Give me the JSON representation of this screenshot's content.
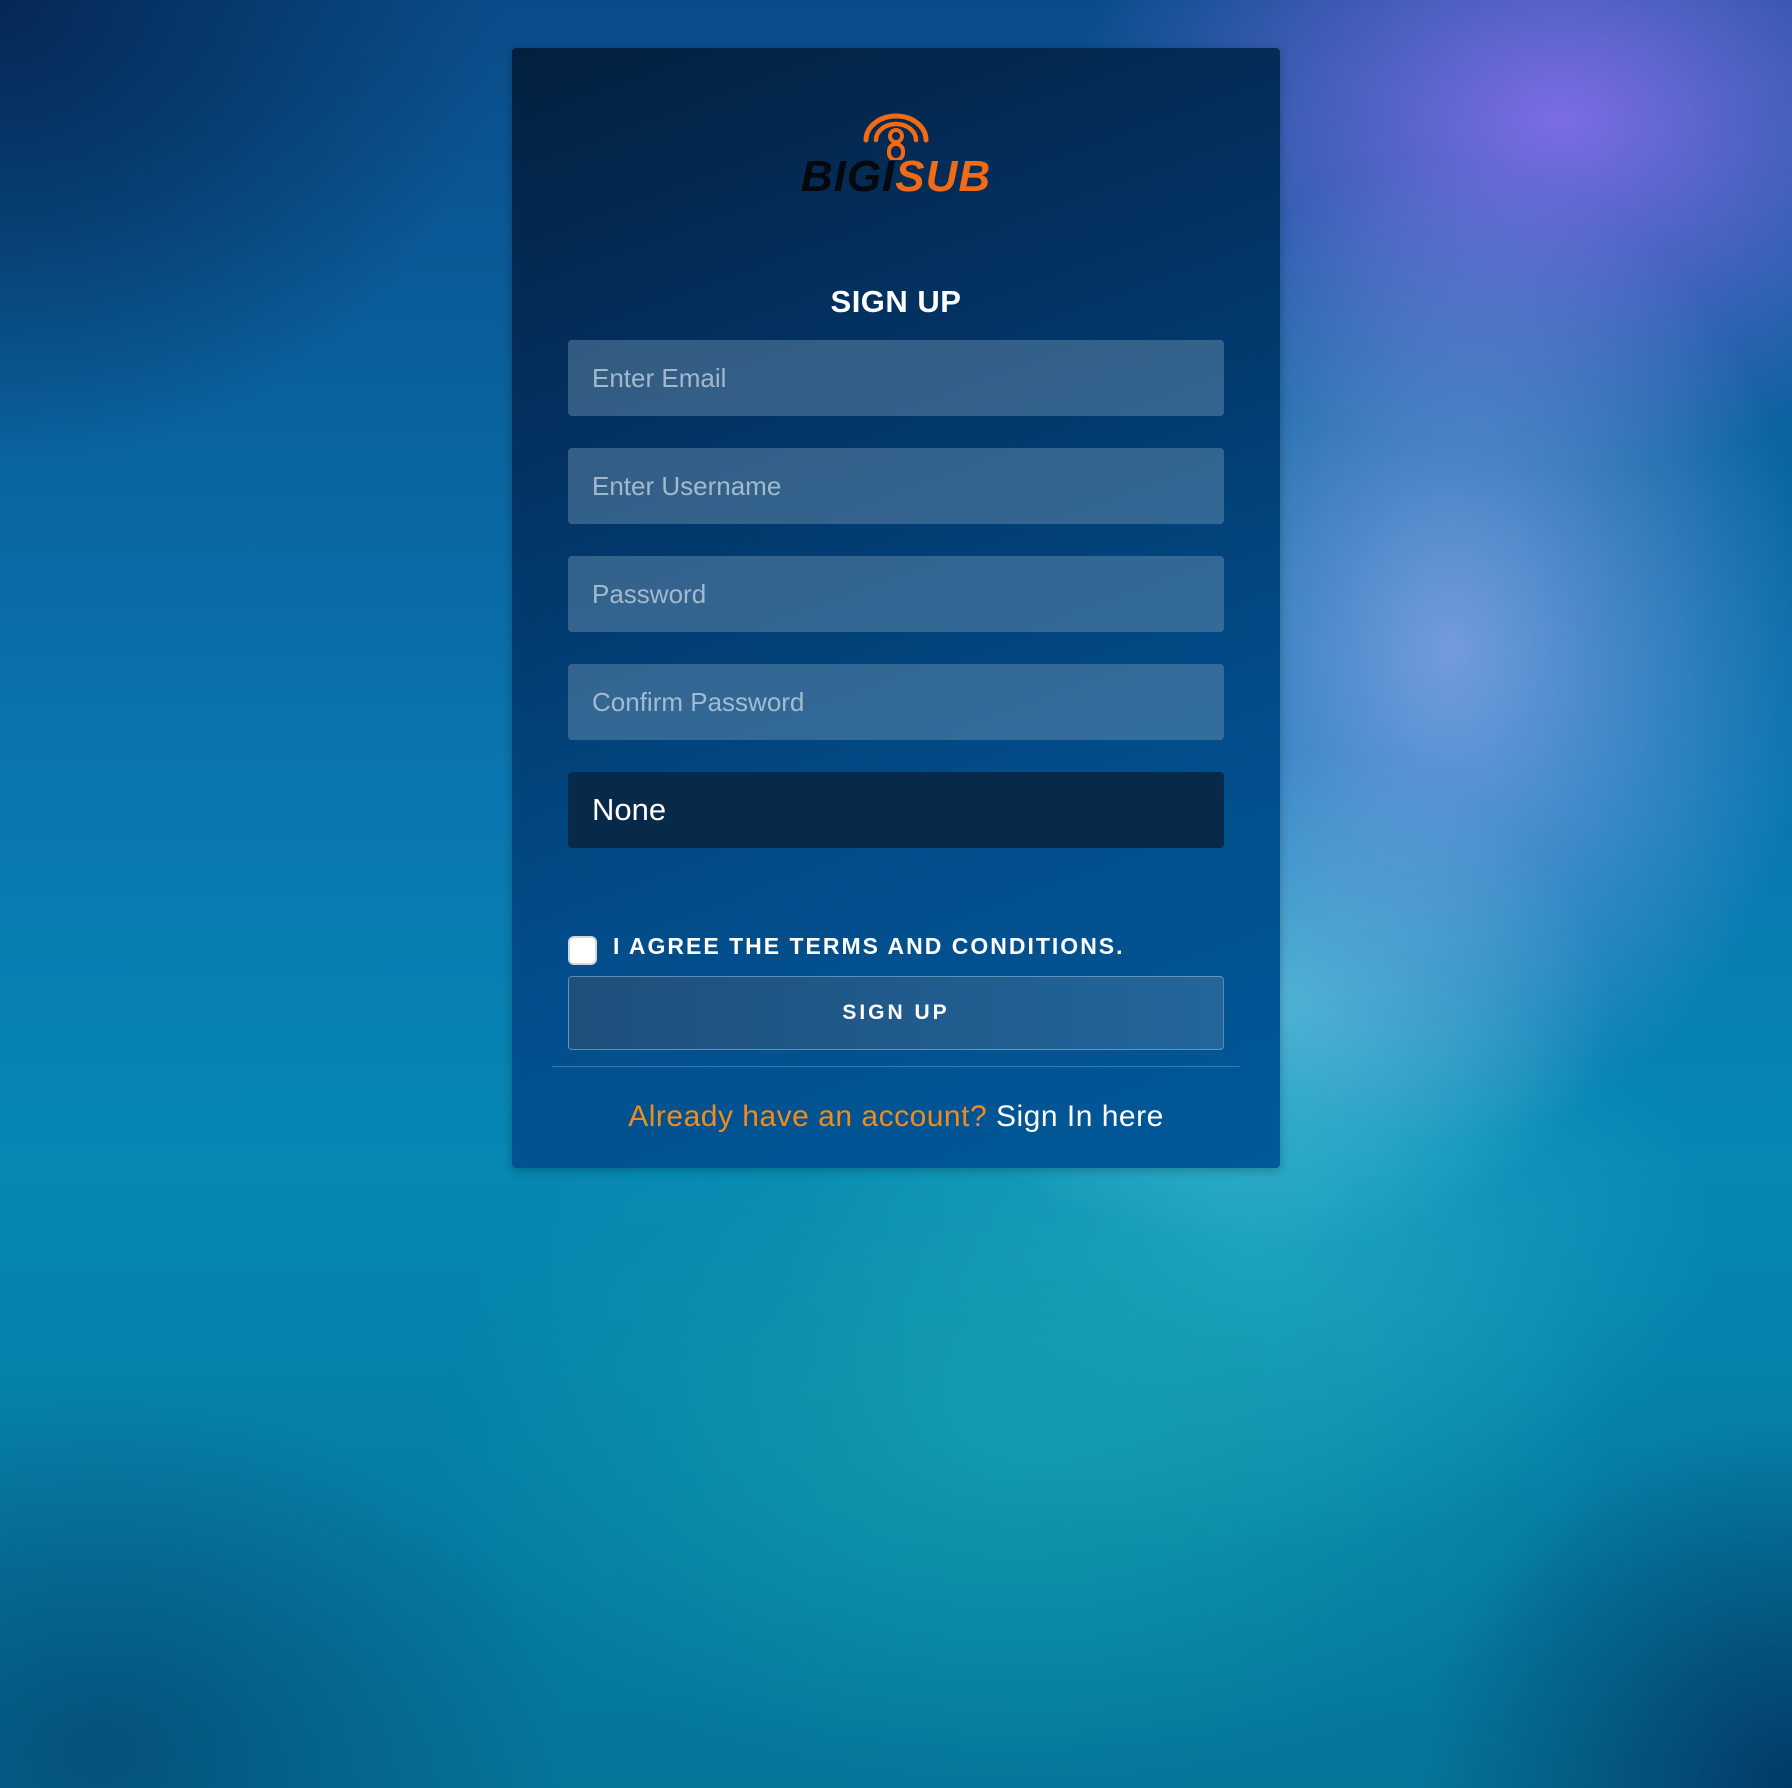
{
  "brand": {
    "name_dark": "BIGI",
    "name_orange": "SUB",
    "icon": "podcast-microphone-icon",
    "colors": {
      "dark": "#05080d",
      "orange": "#f26a14"
    }
  },
  "form": {
    "title": "SIGN UP",
    "email_placeholder": "Enter Email",
    "username_placeholder": "Enter Username",
    "password_placeholder": "Password",
    "confirm_password_placeholder": "Confirm Password",
    "select_value": "None",
    "terms_label": "I AGREE THE TERMS AND CONDITIONS.",
    "terms_checked": false,
    "submit_label": "SIGN UP"
  },
  "footer": {
    "prompt": "Already have an account?",
    "link_label": "Sign In here"
  },
  "theme": {
    "accent_orange": "#f08c1c",
    "card_dark": "#03203f",
    "card_blue": "#01599a"
  }
}
